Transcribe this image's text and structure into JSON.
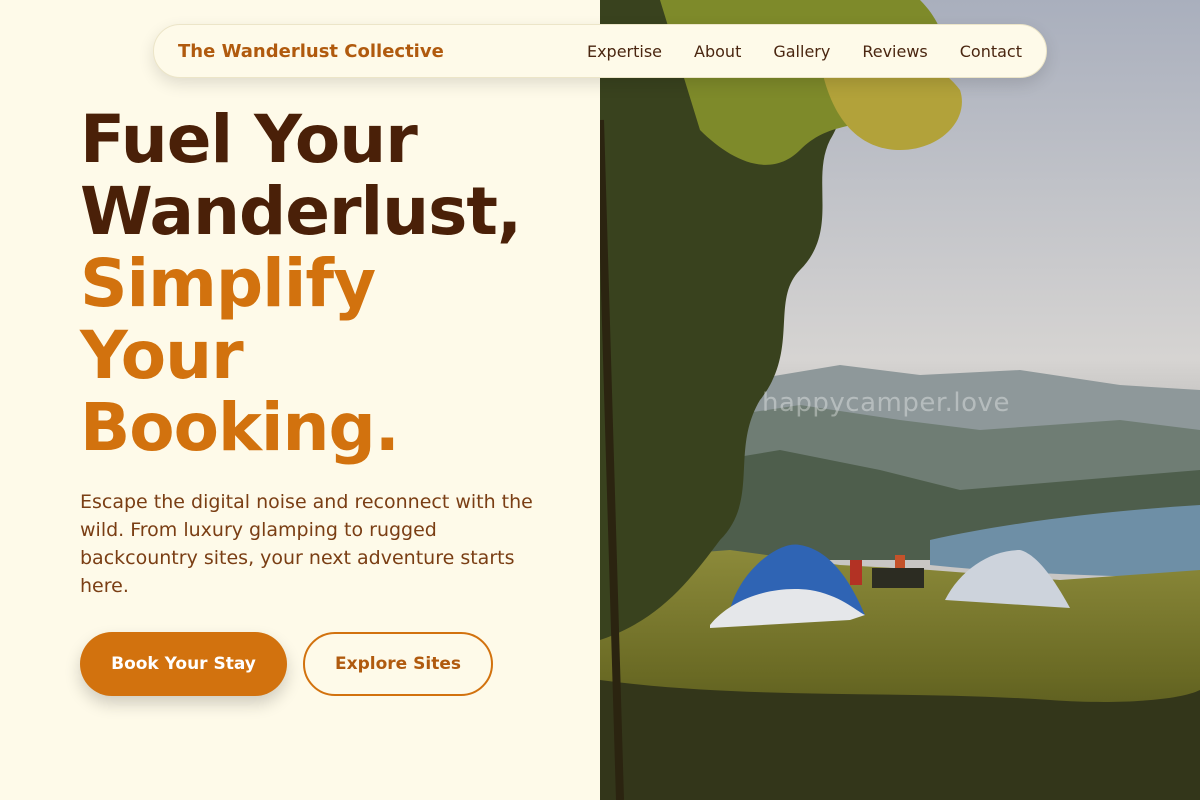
{
  "nav": {
    "brand": "The Wanderlust Collective",
    "links": [
      "Expertise",
      "About",
      "Gallery",
      "Reviews",
      "Contact"
    ]
  },
  "hero": {
    "title_dark_line1": "Fuel Your",
    "title_dark_line2": "Wanderlust,",
    "title_accent_line1": "Simplify",
    "title_accent_line2": "Your",
    "title_accent_line3": "Booking.",
    "description": "Escape the digital noise and reconnect with the wild. From luxury glamping to rugged backcountry sites, your next adventure starts here.",
    "primary_button": "Book Your Stay",
    "secondary_button": "Explore Sites"
  },
  "photo": {
    "watermark": "happycamper.love"
  },
  "colors": {
    "background": "#FEFAE9",
    "accent": "#D2720E",
    "dark_text": "#4A2008",
    "brand": "#B05A0E"
  }
}
